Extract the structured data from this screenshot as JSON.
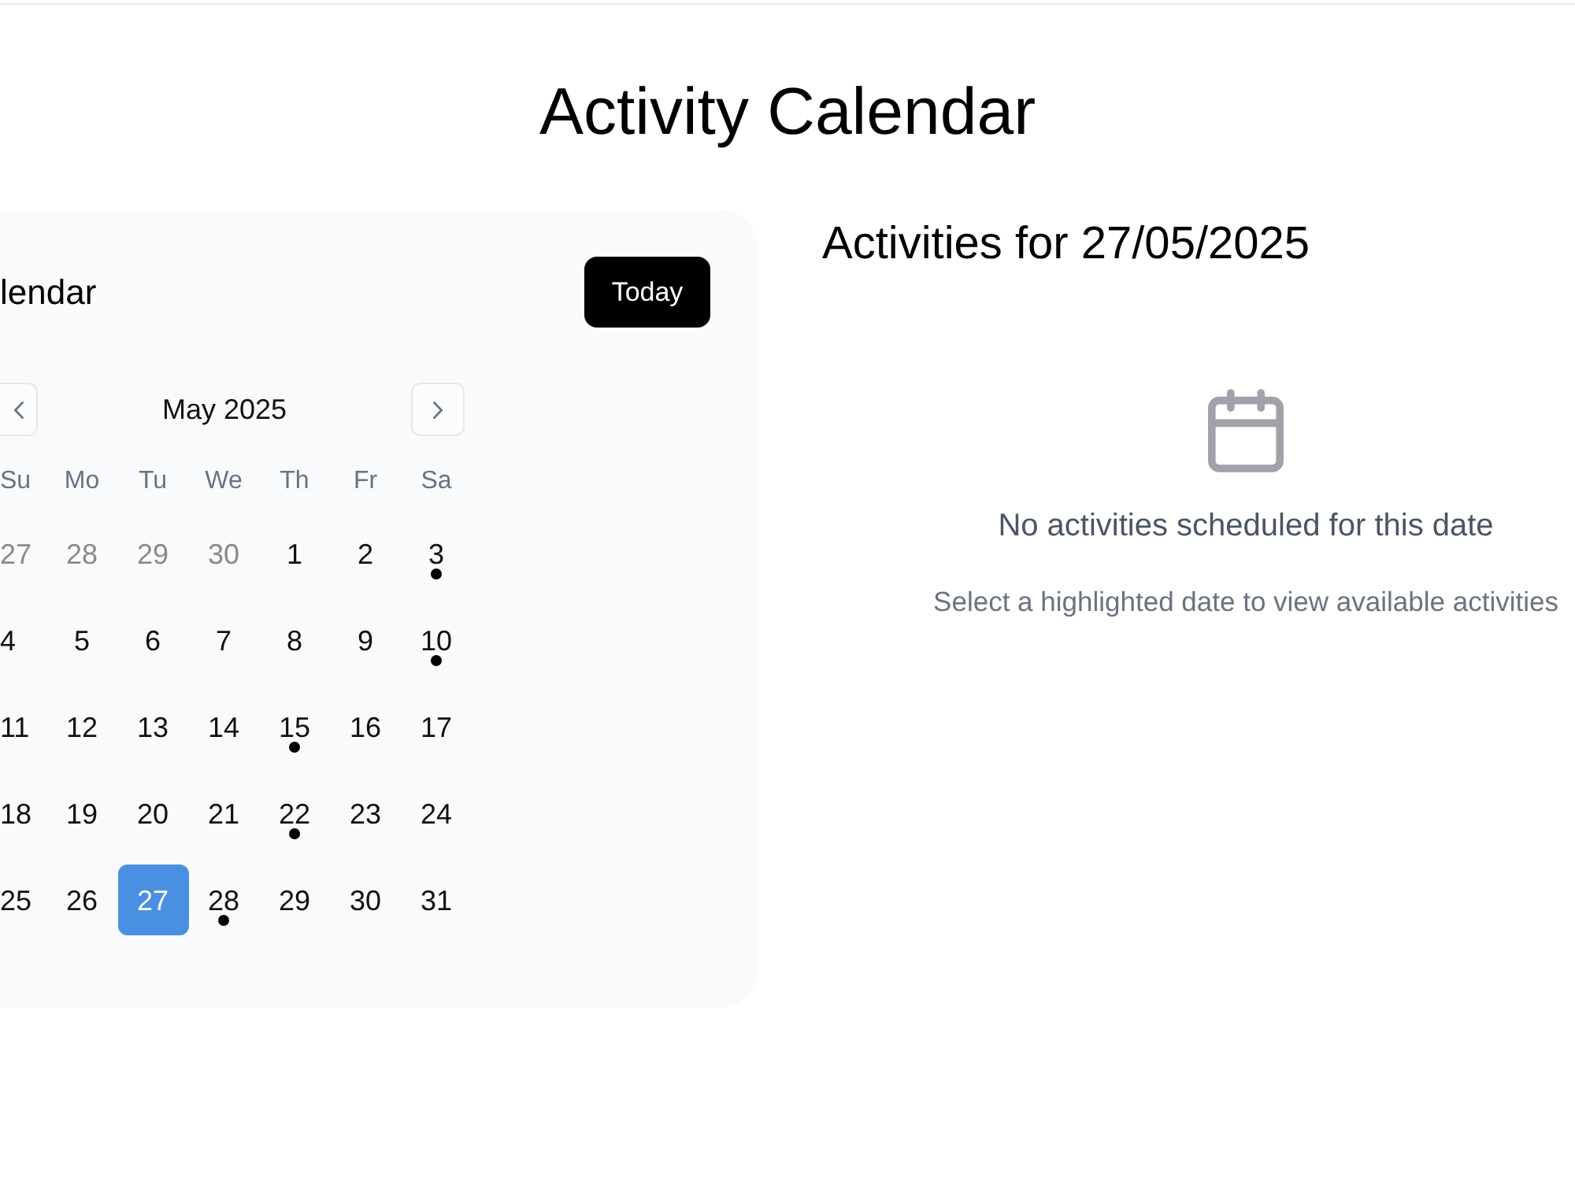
{
  "page": {
    "title": "Activity Calendar"
  },
  "calendar": {
    "title": "lendar",
    "today_button": "Today",
    "month_label": "May 2025",
    "weekdays": [
      "Su",
      "Mo",
      "Tu",
      "We",
      "Th",
      "Fr",
      "Sa"
    ],
    "weeks": [
      [
        {
          "day": "27",
          "outside_month": true,
          "has_activity": false,
          "selected": false
        },
        {
          "day": "28",
          "outside_month": true,
          "has_activity": false,
          "selected": false
        },
        {
          "day": "29",
          "outside_month": true,
          "has_activity": false,
          "selected": false
        },
        {
          "day": "30",
          "outside_month": true,
          "has_activity": false,
          "selected": false
        },
        {
          "day": "1",
          "outside_month": false,
          "has_activity": false,
          "selected": false
        },
        {
          "day": "2",
          "outside_month": false,
          "has_activity": false,
          "selected": false
        },
        {
          "day": "3",
          "outside_month": false,
          "has_activity": true,
          "selected": false
        }
      ],
      [
        {
          "day": "4",
          "outside_month": false,
          "has_activity": false,
          "selected": false
        },
        {
          "day": "5",
          "outside_month": false,
          "has_activity": false,
          "selected": false
        },
        {
          "day": "6",
          "outside_month": false,
          "has_activity": false,
          "selected": false
        },
        {
          "day": "7",
          "outside_month": false,
          "has_activity": false,
          "selected": false
        },
        {
          "day": "8",
          "outside_month": false,
          "has_activity": false,
          "selected": false
        },
        {
          "day": "9",
          "outside_month": false,
          "has_activity": false,
          "selected": false
        },
        {
          "day": "10",
          "outside_month": false,
          "has_activity": true,
          "selected": false
        }
      ],
      [
        {
          "day": "11",
          "outside_month": false,
          "has_activity": false,
          "selected": false
        },
        {
          "day": "12",
          "outside_month": false,
          "has_activity": false,
          "selected": false
        },
        {
          "day": "13",
          "outside_month": false,
          "has_activity": false,
          "selected": false
        },
        {
          "day": "14",
          "outside_month": false,
          "has_activity": false,
          "selected": false
        },
        {
          "day": "15",
          "outside_month": false,
          "has_activity": true,
          "selected": false
        },
        {
          "day": "16",
          "outside_month": false,
          "has_activity": false,
          "selected": false
        },
        {
          "day": "17",
          "outside_month": false,
          "has_activity": false,
          "selected": false
        }
      ],
      [
        {
          "day": "18",
          "outside_month": false,
          "has_activity": false,
          "selected": false
        },
        {
          "day": "19",
          "outside_month": false,
          "has_activity": false,
          "selected": false
        },
        {
          "day": "20",
          "outside_month": false,
          "has_activity": false,
          "selected": false
        },
        {
          "day": "21",
          "outside_month": false,
          "has_activity": false,
          "selected": false
        },
        {
          "day": "22",
          "outside_month": false,
          "has_activity": true,
          "selected": false
        },
        {
          "day": "23",
          "outside_month": false,
          "has_activity": false,
          "selected": false
        },
        {
          "day": "24",
          "outside_month": false,
          "has_activity": false,
          "selected": false
        }
      ],
      [
        {
          "day": "25",
          "outside_month": false,
          "has_activity": false,
          "selected": false
        },
        {
          "day": "26",
          "outside_month": false,
          "has_activity": false,
          "selected": false
        },
        {
          "day": "27",
          "outside_month": false,
          "has_activity": false,
          "selected": true
        },
        {
          "day": "28",
          "outside_month": false,
          "has_activity": true,
          "selected": false
        },
        {
          "day": "29",
          "outside_month": false,
          "has_activity": false,
          "selected": false
        },
        {
          "day": "30",
          "outside_month": false,
          "has_activity": false,
          "selected": false
        },
        {
          "day": "31",
          "outside_month": false,
          "has_activity": false,
          "selected": false
        }
      ]
    ]
  },
  "activities": {
    "heading": "Activities for 27/05/2025",
    "empty_title": "No activities scheduled for this date",
    "empty_hint": "Select a highlighted date to view available activities"
  }
}
